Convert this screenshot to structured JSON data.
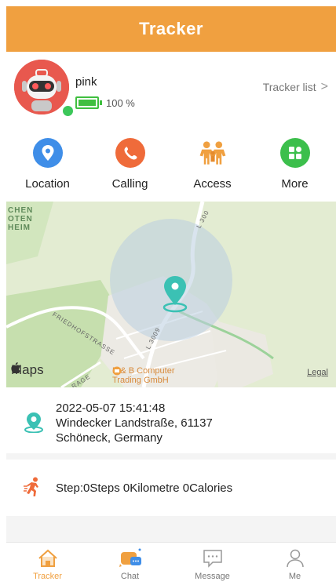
{
  "header": {
    "title": "Tracker"
  },
  "profile": {
    "name": "pink",
    "battery_percent": 100,
    "battery_label": "100 %",
    "tracker_list_label": "Tracker list",
    "chevron": ">"
  },
  "menu": {
    "items": [
      {
        "label": "Location",
        "icon": "location-icon",
        "color": "#3f8ee8"
      },
      {
        "label": "Calling",
        "icon": "phone-icon",
        "color": "#ef6b3a"
      },
      {
        "label": "Access",
        "icon": "family-icon",
        "color": "#f0a040"
      },
      {
        "label": "More",
        "icon": "grid-icon",
        "color": "#3cbf4c"
      }
    ]
  },
  "map": {
    "place_label": "CHEN\nOTEN\nHEIM",
    "roads": [
      "L 300",
      "FRIEDHOFSTRASSE",
      "L 3009",
      "RAGE"
    ],
    "poi_label": "B & B Computer\nTrading GmbH",
    "maps_brand": "Maps",
    "legal_label": "Legal"
  },
  "location": {
    "datetime": "2022-05-07 15:41:48",
    "street": "Windecker Landstraße, 61137",
    "city": "Schöneck, Germany"
  },
  "activity": {
    "text": "Step:0Steps 0Kilometre 0Calories"
  },
  "tabbar": {
    "tabs": [
      {
        "label": "Tracker",
        "icon": "home-icon",
        "active": true
      },
      {
        "label": "Chat",
        "icon": "chat-icon",
        "active": false
      },
      {
        "label": "Message",
        "icon": "message-icon",
        "active": false
      },
      {
        "label": "Me",
        "icon": "person-icon",
        "active": false
      }
    ]
  },
  "colors": {
    "accent": "#f0a040",
    "teal": "#3bc1b4",
    "green": "#3fbf3f"
  }
}
